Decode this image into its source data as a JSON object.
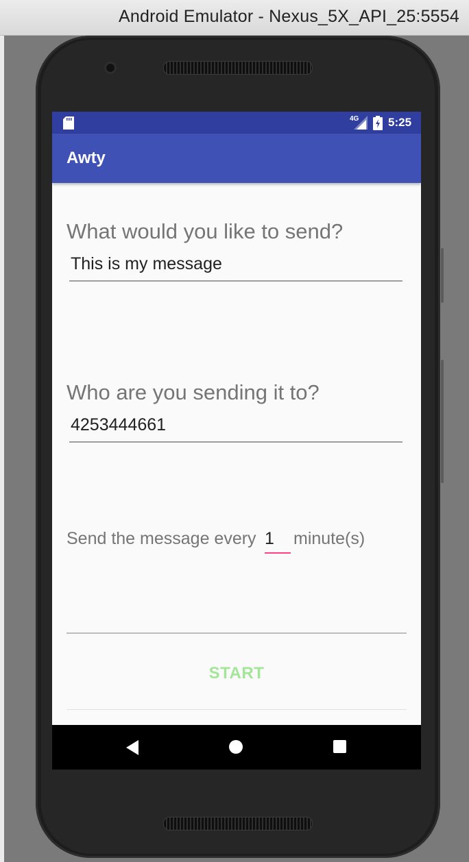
{
  "window": {
    "title": "Android Emulator - Nexus_5X_API_25:5554"
  },
  "status_bar": {
    "network_label": "4G",
    "time": "5:25",
    "icons": [
      "sd-card-icon",
      "signal-icon",
      "battery-icon"
    ]
  },
  "app_bar": {
    "title": "Awty",
    "color": "#3f51b5",
    "status_color": "#303f9f"
  },
  "form": {
    "message_label": "What would you like to send?",
    "message_value": "This is my message",
    "recipient_label": "Who are you sending it to?",
    "recipient_value": "4253444661",
    "interval_prefix": "Send the message every",
    "interval_value": "1",
    "interval_suffix": "minute(s)",
    "accent_color": "#ff4081"
  },
  "actions": {
    "start_label": "START",
    "start_color": "#a5e59a"
  },
  "nav_bar": {
    "buttons": [
      "back-icon",
      "home-icon",
      "recents-icon"
    ]
  }
}
